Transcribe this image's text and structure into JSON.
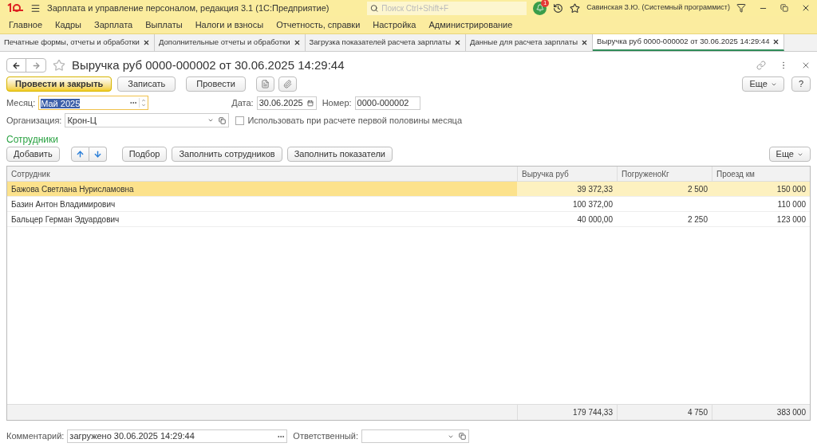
{
  "window": {
    "title": "Зарплата и управление персоналом, редакция 3.1  (1С:Предприятие)",
    "search_placeholder": "Поиск Ctrl+Shift+F",
    "notifications": "1",
    "user": "Савинская З.Ю. (Системный программист)"
  },
  "menu": [
    "Главное",
    "Кадры",
    "Зарплата",
    "Выплаты",
    "Налоги и взносы",
    "Отчетность, справки",
    "Настройка",
    "Администрирование"
  ],
  "tabs": [
    {
      "label": "Печатные формы, отчеты и обработки",
      "selected": false
    },
    {
      "label": "Дополнительные отчеты и обработки",
      "selected": false
    },
    {
      "label": "Загрузка показателей расчета зарплаты",
      "selected": false
    },
    {
      "label": "Данные для расчета зарплаты",
      "selected": false
    },
    {
      "label": "Выручка руб 0000-000002 от 30.06.2025 14:29:44",
      "selected": true
    }
  ],
  "document": {
    "title": "Выручка руб 0000-000002 от 30.06.2025 14:29:44",
    "buttons": [
      {
        "label": "Провести и закрыть",
        "primary": true
      },
      {
        "label": "Записать",
        "primary": false
      },
      {
        "label": "Провести",
        "primary": false
      }
    ],
    "more": "Еще",
    "help": "?",
    "month": {
      "label": "Месяц:",
      "value": "Май 2025"
    },
    "date": {
      "label": "Дата:",
      "value": "30.06.2025"
    },
    "number": {
      "label": "Номер:",
      "value": "0000-000002"
    },
    "organization": {
      "label": "Организация:",
      "value": "Крон-Ц"
    },
    "first_half": {
      "label": "Использовать при расчете первой половины месяца",
      "checked": false
    },
    "section": "Сотрудники",
    "table_buttons": [
      "Добавить",
      "Подбор",
      "Заполнить сотрудников",
      "Заполнить показатели"
    ],
    "table_more": "Еще",
    "table": {
      "columns": [
        "Сотрудник",
        "Выручка руб",
        "ПогруженоКг",
        "Проезд км"
      ],
      "rows": [
        {
          "cells": [
            "Бажова Светлана Нурисламовна",
            "39 372,33",
            "2 500",
            "150 000"
          ],
          "selected": true
        },
        {
          "cells": [
            "Базин Антон Владимирович",
            "100 372,00",
            "",
            "110 000"
          ],
          "selected": false
        },
        {
          "cells": [
            "Бальцер Герман Эдуардович",
            "40 000,00",
            "2 250",
            "123 000"
          ],
          "selected": false
        }
      ],
      "totals": [
        "179 744,33",
        "4 750",
        "383 000"
      ]
    },
    "comment": {
      "label": "Комментарий:",
      "value": "загружено 30.06.2025 14:29:44"
    },
    "responsible": {
      "label": "Ответственный:"
    }
  }
}
